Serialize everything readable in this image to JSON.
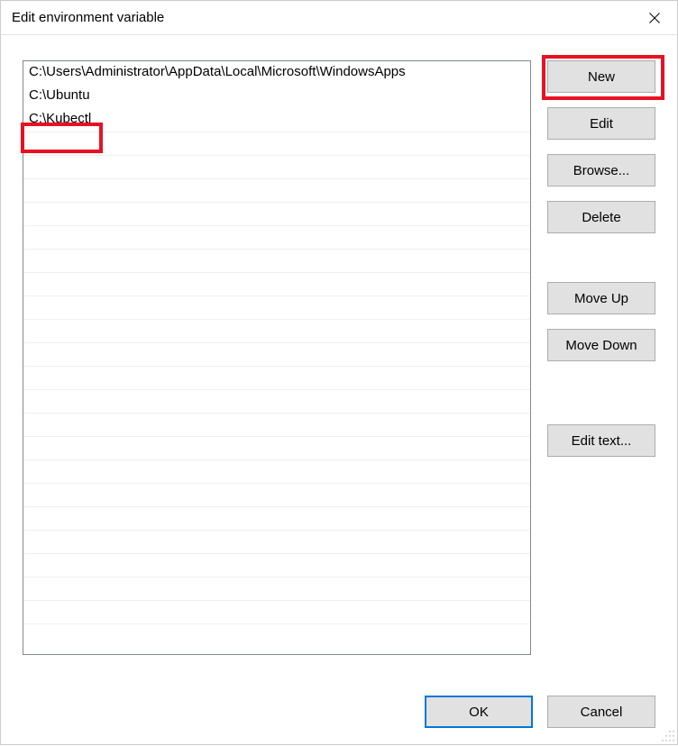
{
  "titlebar": {
    "title": "Edit environment variable"
  },
  "list": {
    "items": [
      "C:\\Users\\Administrator\\AppData\\Local\\Microsoft\\WindowsApps",
      "C:\\Ubuntu",
      "C:\\Kubectl"
    ]
  },
  "buttons": {
    "new": "New",
    "edit": "Edit",
    "browse": "Browse...",
    "delete": "Delete",
    "moveUp": "Move Up",
    "moveDown": "Move Down",
    "editText": "Edit text...",
    "ok": "OK",
    "cancel": "Cancel"
  }
}
